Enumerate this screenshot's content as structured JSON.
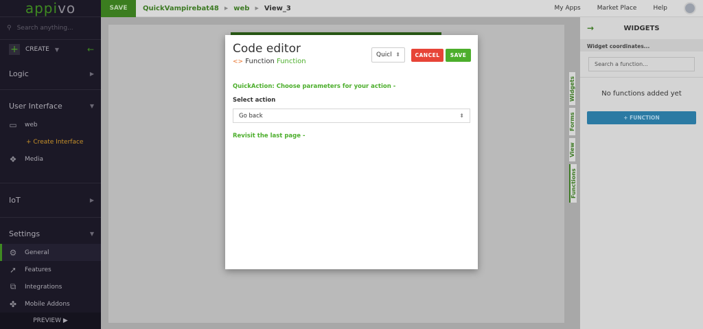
{
  "sidebar": {
    "logo_main": "appi",
    "logo_tail": "vo",
    "search_placeholder": "Search anything...",
    "create_label": "CREATE",
    "logic": "Logic",
    "user_interface": "User Interface",
    "web": "web",
    "create_interface": "+ Create Interface",
    "media": "Media",
    "iot": "IoT",
    "settings": "Settings",
    "settings_items": [
      {
        "label": "General"
      },
      {
        "label": "Features"
      },
      {
        "label": "Integrations"
      },
      {
        "label": "Mobile Addons"
      }
    ],
    "preview": "PREVIEW ▶"
  },
  "topbar": {
    "save": "SAVE",
    "breadcrumb": [
      "QuickVampirebat48",
      "web",
      "View_3"
    ],
    "nav": [
      "My Apps",
      "Market Place",
      "Help"
    ]
  },
  "vertical_tabs": [
    "Widgets",
    "Forms",
    "View",
    "Functions"
  ],
  "right_panel": {
    "title": "WIDGETS",
    "coords": "Widget coordinates...",
    "search_placeholder": "Search a function...",
    "empty": "No functions added yet",
    "add_button": "+ FUNCTION"
  },
  "modal": {
    "title": "Code editor",
    "code_icon": "<>",
    "subtitle_type": "Function",
    "subtitle_name": "Function",
    "quick_select": "Quicl",
    "cancel": "CANCEL",
    "save": "SAVE",
    "quickaction": "QuickAction: Choose parameters for your action -",
    "select_label": "Select action",
    "selected_action": "Go back",
    "description": "Revisit the last page -"
  }
}
